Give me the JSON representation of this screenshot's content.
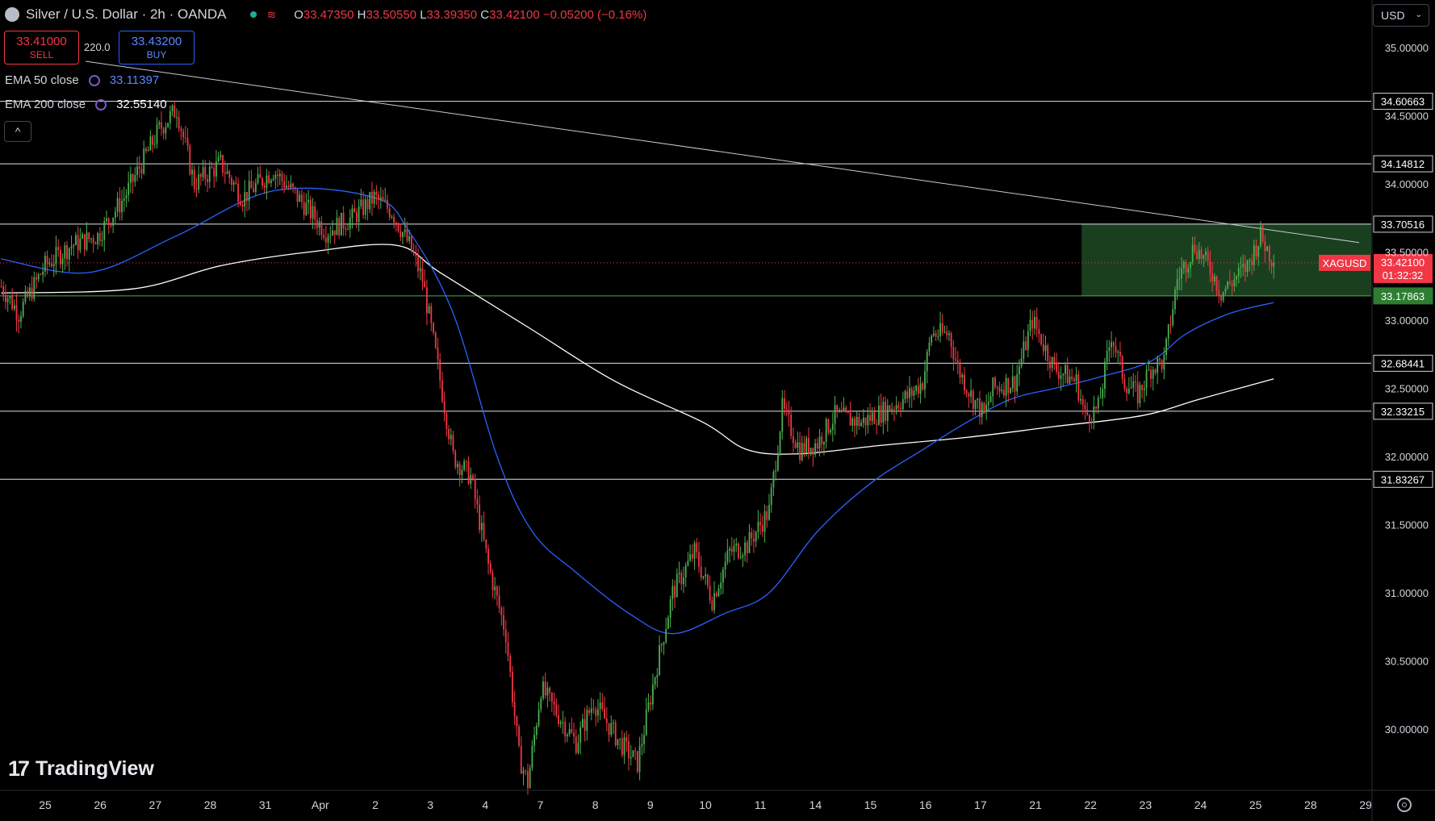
{
  "header": {
    "title": "Silver / U.S. Dollar · 2h · OANDA",
    "ohlc": [
      {
        "key": "O",
        "value": "33.47350"
      },
      {
        "key": "H",
        "value": "33.50550"
      },
      {
        "key": "L",
        "value": "33.39350"
      },
      {
        "key": "C",
        "value": "33.42100"
      }
    ],
    "change": "−0.05200 (−0.16%)",
    "icons": [
      "silver-symbol-icon",
      "market-open-icon",
      "wave-icon"
    ]
  },
  "trade": {
    "sell_price": "33.41000",
    "sell_label": "SELL",
    "spread": "220.0",
    "buy_price": "33.43200",
    "buy_label": "BUY"
  },
  "indicators": [
    {
      "label": "EMA 50 close",
      "value": "33.11397",
      "color": "#2962ff"
    },
    {
      "label": "EMA 200 close",
      "value": "32.55140",
      "color": "#ffffff"
    }
  ],
  "collapse_label": "^",
  "logo": "TradingView",
  "currency": "USD",
  "colors": {
    "up": "#4caf50",
    "down": "#f23645",
    "ema50": "#2962ff",
    "ema200": "#ffffff",
    "zone": "#1f4a24",
    "background": "#000000"
  },
  "chart_data": {
    "type": "candlestick",
    "symbol": "XAGUSD",
    "current_price": "33.42100",
    "countdown": "01:32:32",
    "ylim": [
      29.55,
      35.35
    ],
    "y_ticks": [
      "35.00000",
      "34.50000",
      "34.00000",
      "33.50000",
      "33.00000",
      "32.50000",
      "32.00000",
      "31.50000",
      "31.00000",
      "30.50000",
      "30.00000"
    ],
    "x_ticks": [
      "25",
      "26",
      "27",
      "28",
      "31",
      "Apr",
      "2",
      "3",
      "4",
      "7",
      "8",
      "9",
      "10",
      "11",
      "14",
      "15",
      "16",
      "17",
      "21",
      "22",
      "23",
      "24",
      "25",
      "28",
      "29"
    ],
    "levels": [
      "34.60663",
      "34.14812",
      "33.70516",
      "33.17863",
      "32.68441",
      "32.33215",
      "31.83267"
    ],
    "zone": {
      "top": 33.70516,
      "bottom": 33.17863,
      "start_tick": "22",
      "end": "chart edge"
    },
    "trendline": {
      "from": {
        "tick": "25",
        "y": 34.9
      },
      "to": {
        "tick": "29",
        "y": 33.57
      }
    },
    "anchors": [
      [
        0,
        33.25
      ],
      [
        8,
        33.05
      ],
      [
        20,
        33.4
      ],
      [
        32,
        33.55
      ],
      [
        44,
        33.62
      ],
      [
        56,
        33.9
      ],
      [
        72,
        34.4
      ],
      [
        80,
        34.55
      ],
      [
        88,
        34.0
      ],
      [
        100,
        34.15
      ],
      [
        110,
        33.9
      ],
      [
        124,
        34.1
      ],
      [
        138,
        33.85
      ],
      [
        148,
        33.65
      ],
      [
        160,
        33.75
      ],
      [
        170,
        33.9
      ],
      [
        178,
        33.8
      ],
      [
        186,
        33.55
      ],
      [
        192,
        33.3
      ],
      [
        198,
        32.75
      ],
      [
        206,
        32.0
      ],
      [
        214,
        31.85
      ],
      [
        222,
        31.2
      ],
      [
        230,
        30.7
      ],
      [
        236,
        29.8
      ],
      [
        240,
        29.6
      ],
      [
        246,
        30.3
      ],
      [
        254,
        30.1
      ],
      [
        262,
        29.9
      ],
      [
        270,
        30.2
      ],
      [
        282,
        29.9
      ],
      [
        290,
        29.75
      ],
      [
        298,
        30.4
      ],
      [
        306,
        31.0
      ],
      [
        316,
        31.3
      ],
      [
        324,
        30.95
      ],
      [
        332,
        31.3
      ],
      [
        340,
        31.35
      ],
      [
        350,
        31.6
      ],
      [
        356,
        32.35
      ],
      [
        364,
        32.05
      ],
      [
        372,
        32.1
      ],
      [
        380,
        32.3
      ],
      [
        392,
        32.25
      ],
      [
        404,
        32.35
      ],
      [
        414,
        32.45
      ],
      [
        420,
        32.55
      ],
      [
        424,
        32.9
      ],
      [
        432,
        32.9
      ],
      [
        436,
        32.65
      ],
      [
        442,
        32.45
      ],
      [
        448,
        32.3
      ],
      [
        452,
        32.5
      ],
      [
        462,
        32.55
      ],
      [
        470,
        33.0
      ],
      [
        480,
        32.65
      ],
      [
        490,
        32.55
      ],
      [
        494,
        32.3
      ],
      [
        500,
        32.35
      ],
      [
        506,
        32.9
      ],
      [
        512,
        32.55
      ],
      [
        518,
        32.45
      ],
      [
        524,
        32.65
      ],
      [
        530,
        32.7
      ],
      [
        536,
        33.3
      ],
      [
        544,
        33.55
      ],
      [
        552,
        33.35
      ],
      [
        556,
        33.2
      ],
      [
        562,
        33.3
      ],
      [
        568,
        33.4
      ],
      [
        574,
        33.62
      ],
      [
        580,
        33.42
      ]
    ],
    "ema50_knots": [
      [
        0,
        33.45
      ],
      [
        40,
        33.35
      ],
      [
        80,
        33.62
      ],
      [
        124,
        33.95
      ],
      [
        170,
        33.9
      ],
      [
        186,
        33.65
      ],
      [
        206,
        33.05
      ],
      [
        226,
        32.0
      ],
      [
        242,
        31.45
      ],
      [
        262,
        31.15
      ],
      [
        286,
        30.85
      ],
      [
        306,
        30.7
      ],
      [
        330,
        30.85
      ],
      [
        350,
        31.0
      ],
      [
        372,
        31.45
      ],
      [
        396,
        31.8
      ],
      [
        420,
        32.05
      ],
      [
        440,
        32.25
      ],
      [
        460,
        32.42
      ],
      [
        480,
        32.5
      ],
      [
        500,
        32.58
      ],
      [
        524,
        32.7
      ],
      [
        540,
        32.9
      ],
      [
        560,
        33.05
      ],
      [
        580,
        33.13
      ]
    ],
    "ema200_knots": [
      [
        0,
        33.2
      ],
      [
        60,
        33.23
      ],
      [
        100,
        33.4
      ],
      [
        140,
        33.5
      ],
      [
        180,
        33.55
      ],
      [
        200,
        33.35
      ],
      [
        240,
        32.95
      ],
      [
        280,
        32.55
      ],
      [
        320,
        32.25
      ],
      [
        340,
        32.05
      ],
      [
        364,
        32.02
      ],
      [
        400,
        32.08
      ],
      [
        440,
        32.14
      ],
      [
        480,
        32.22
      ],
      [
        520,
        32.3
      ],
      [
        546,
        32.42
      ],
      [
        580,
        32.57
      ]
    ]
  }
}
